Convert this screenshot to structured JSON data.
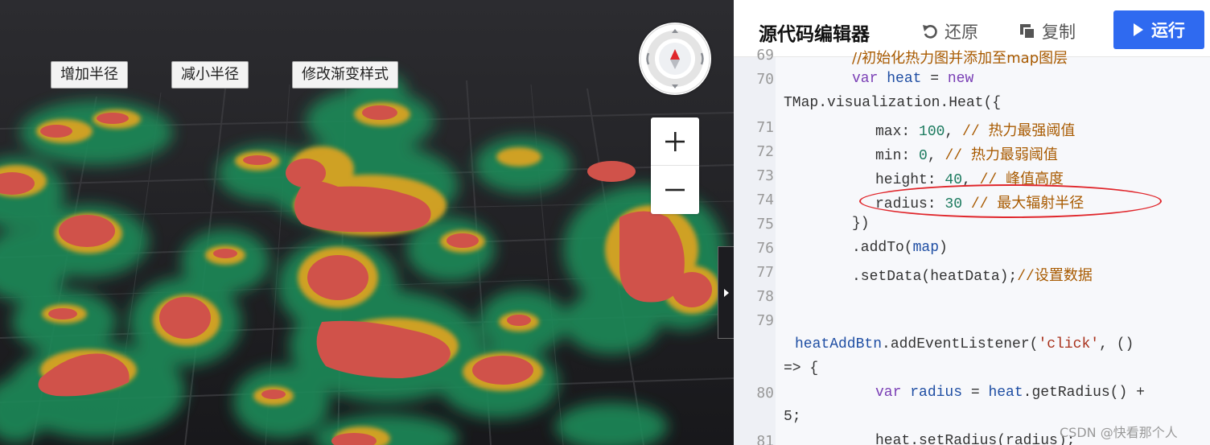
{
  "map": {
    "buttons": [
      "增加半径",
      "减小半径",
      "修改渐变样式"
    ],
    "zoom_in": "+",
    "zoom_out": "−",
    "colors": {
      "hot": "#d0524a",
      "warm": "#e0a020",
      "cool": "#1e8a58",
      "base": "#1f1f23",
      "road": "#3a3a3e"
    }
  },
  "editor": {
    "title": "源代码编辑器",
    "restore": "还原",
    "copy": "复制",
    "run": "运行",
    "accent": "#2f6af0",
    "watermark": "CSDN @快看那个人",
    "lines": [
      {
        "num": "69",
        "text": "//初始化热力图并添加至map图层"
      },
      {
        "num": "70",
        "text": "var heat = new"
      },
      {
        "num": "",
        "text": "TMap.visualization.Heat({"
      },
      {
        "num": "71",
        "text": "max: 100, // 热力最强阈值"
      },
      {
        "num": "72",
        "text": "min: 0, // 热力最弱阈值"
      },
      {
        "num": "73",
        "text": "height: 40, // 峰值高度"
      },
      {
        "num": "74",
        "text": "radius: 30 // 最大辐射半径"
      },
      {
        "num": "75",
        "text": "})"
      },
      {
        "num": "76",
        "text": ".addTo(map)"
      },
      {
        "num": "77",
        "text": ".setData(heatData);//设置数据"
      },
      {
        "num": "78",
        "text": ""
      },
      {
        "num": "79",
        "text": ""
      },
      {
        "num": "",
        "text": "heatAddBtn.addEventListener('click', ()"
      },
      {
        "num": "",
        "text": "=> {"
      },
      {
        "num": "80",
        "text": "var radius = heat.getRadius() +"
      },
      {
        "num": "",
        "text": "5;"
      },
      {
        "num": "81",
        "text": "heat.setRadius(radius);"
      }
    ]
  }
}
